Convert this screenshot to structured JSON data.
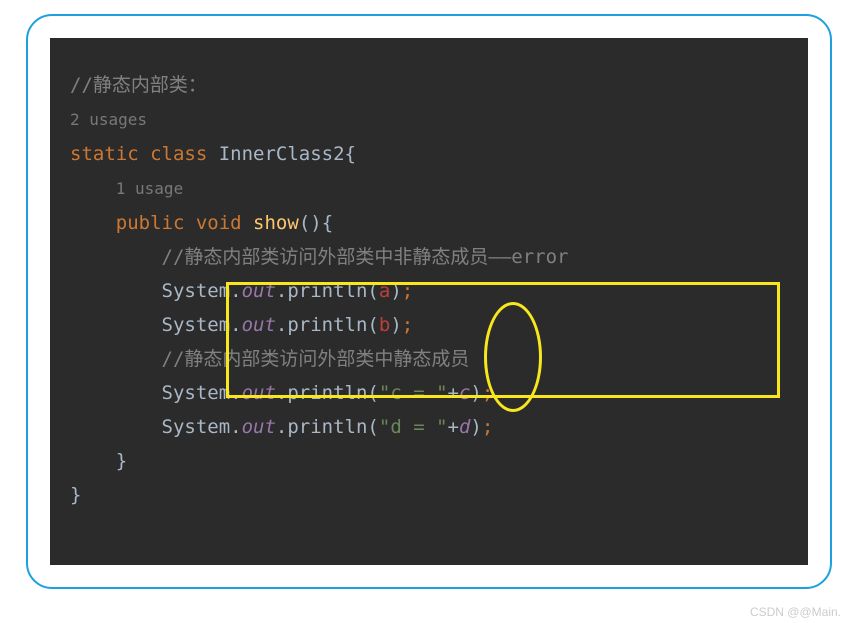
{
  "code": {
    "l1_comment": "//静态内部类：",
    "l2_usage": "2 usages",
    "l3_static": "static",
    "l3_class": " class ",
    "l3_name": "InnerClass2{",
    "l4_usage": "1 usage",
    "l5_public": "public",
    "l5_void": " void ",
    "l5_method": "show",
    "l5_paren": "(){",
    "l6_comment": "//静态内部类访问外部类中非静态成员——error",
    "l7_sys": "System.",
    "l7_out": "out",
    "l7_print": ".println(",
    "l7_var": "a",
    "l7_close": ")",
    "l7_semi": ";",
    "l8_var": "b",
    "l9_comment": "//静态内部类访问外部类中静态成员",
    "l10_str": "\"c = \"",
    "l10_plus": "+",
    "l10_var": "c",
    "l11_str": "\"d = \"",
    "l11_var": "d",
    "l12_brace": "}",
    "l13_brace": "}"
  },
  "indent": {
    "i1": "    ",
    "i2": "        ",
    "i3": "            "
  },
  "watermark": "CSDN @@Main."
}
